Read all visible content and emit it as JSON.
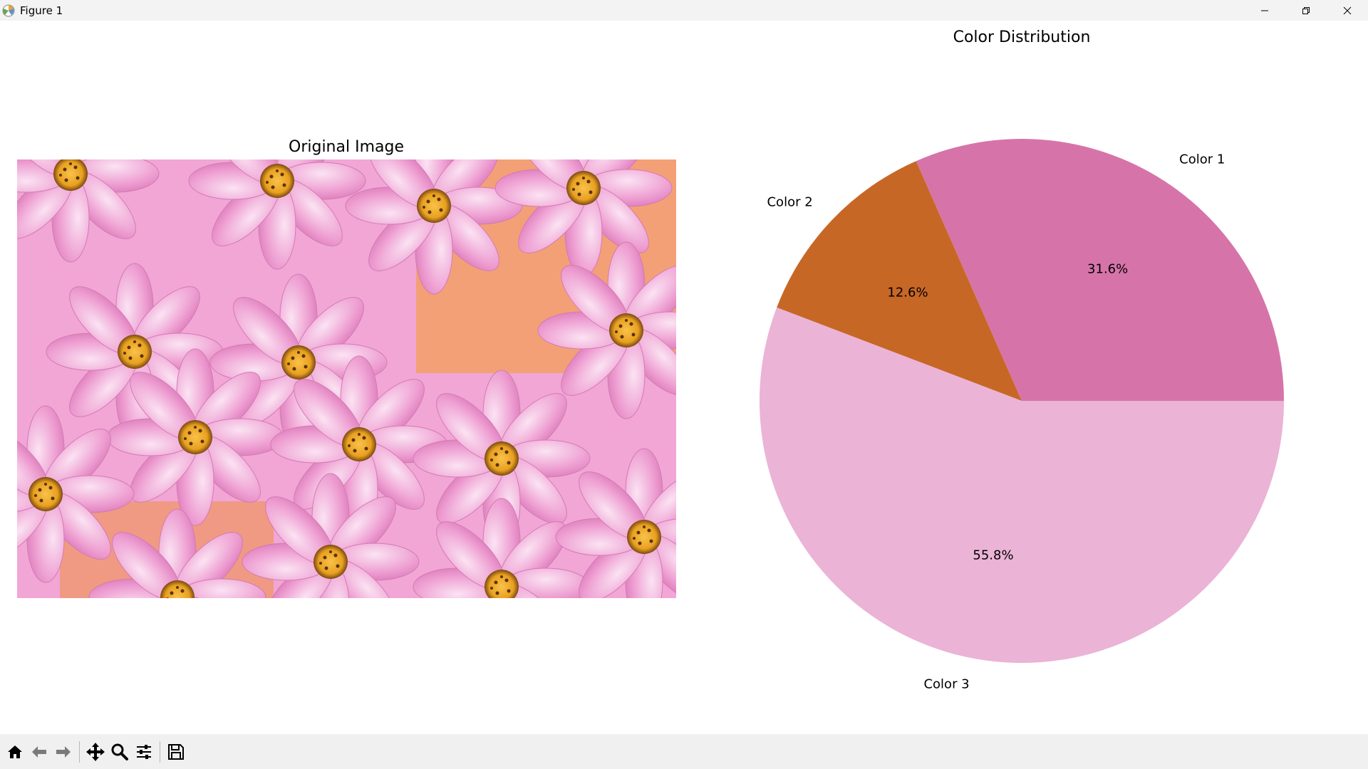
{
  "window": {
    "title": "Figure 1",
    "controls": [
      "minimize",
      "restore",
      "close"
    ]
  },
  "figure": {
    "image_axes": {
      "title": "Original Image"
    },
    "pie_axes": {
      "title": "Color Distribution"
    }
  },
  "chart_data": {
    "type": "pie",
    "title": "Color Distribution",
    "categories": [
      "Color 1",
      "Color 2",
      "Color 3"
    ],
    "values": [
      31.6,
      12.6,
      55.8
    ],
    "labels_pct": [
      "31.6%",
      "12.6%",
      "55.8%"
    ],
    "colors": [
      "#d674a9",
      "#c76726",
      "#ebb3d6"
    ],
    "start_angle_deg": 0,
    "direction": "counterclockwise"
  },
  "toolbar": {
    "buttons": [
      {
        "icon": "home-icon"
      },
      {
        "icon": "back-arrow-icon"
      },
      {
        "icon": "forward-arrow-icon"
      },
      {
        "icon": "pan-icon"
      },
      {
        "icon": "zoom-icon"
      },
      {
        "icon": "configure-subplots-icon"
      },
      {
        "icon": "save-icon"
      }
    ]
  }
}
